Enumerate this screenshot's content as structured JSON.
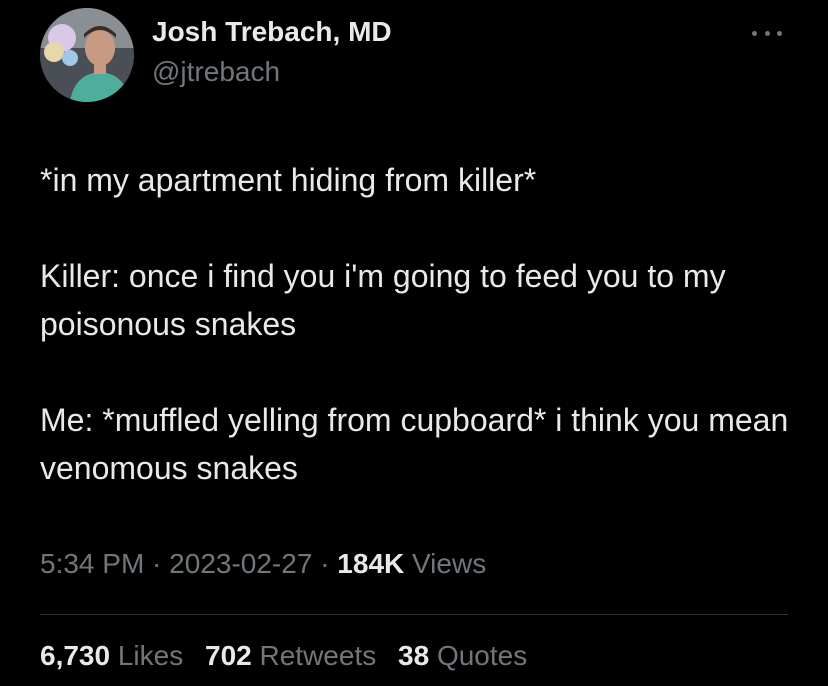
{
  "author": {
    "display_name": "Josh Trebach, MD",
    "handle": "@jtrebach"
  },
  "more_menu_icon": "more-horizontal-icon",
  "tweet": {
    "lines": [
      "*in my apartment hiding from killer*",
      "Killer: once i find you i'm going to feed you to my poisonous snakes",
      "Me: *muffled yelling from cupboard* i think you mean venomous snakes"
    ]
  },
  "meta": {
    "time": "5:34 PM",
    "separator": " · ",
    "date": "2023-02-27",
    "views_count": "184K",
    "views_label": "Views"
  },
  "stats": {
    "likes_count": "6,730",
    "likes_label": "Likes",
    "retweets_count": "702",
    "retweets_label": "Retweets",
    "quotes_count": "38",
    "quotes_label": "Quotes"
  },
  "colors": {
    "background": "#000000",
    "primary_text": "#e7e9ea",
    "secondary_text": "#71767b",
    "divider": "#2f3336"
  }
}
